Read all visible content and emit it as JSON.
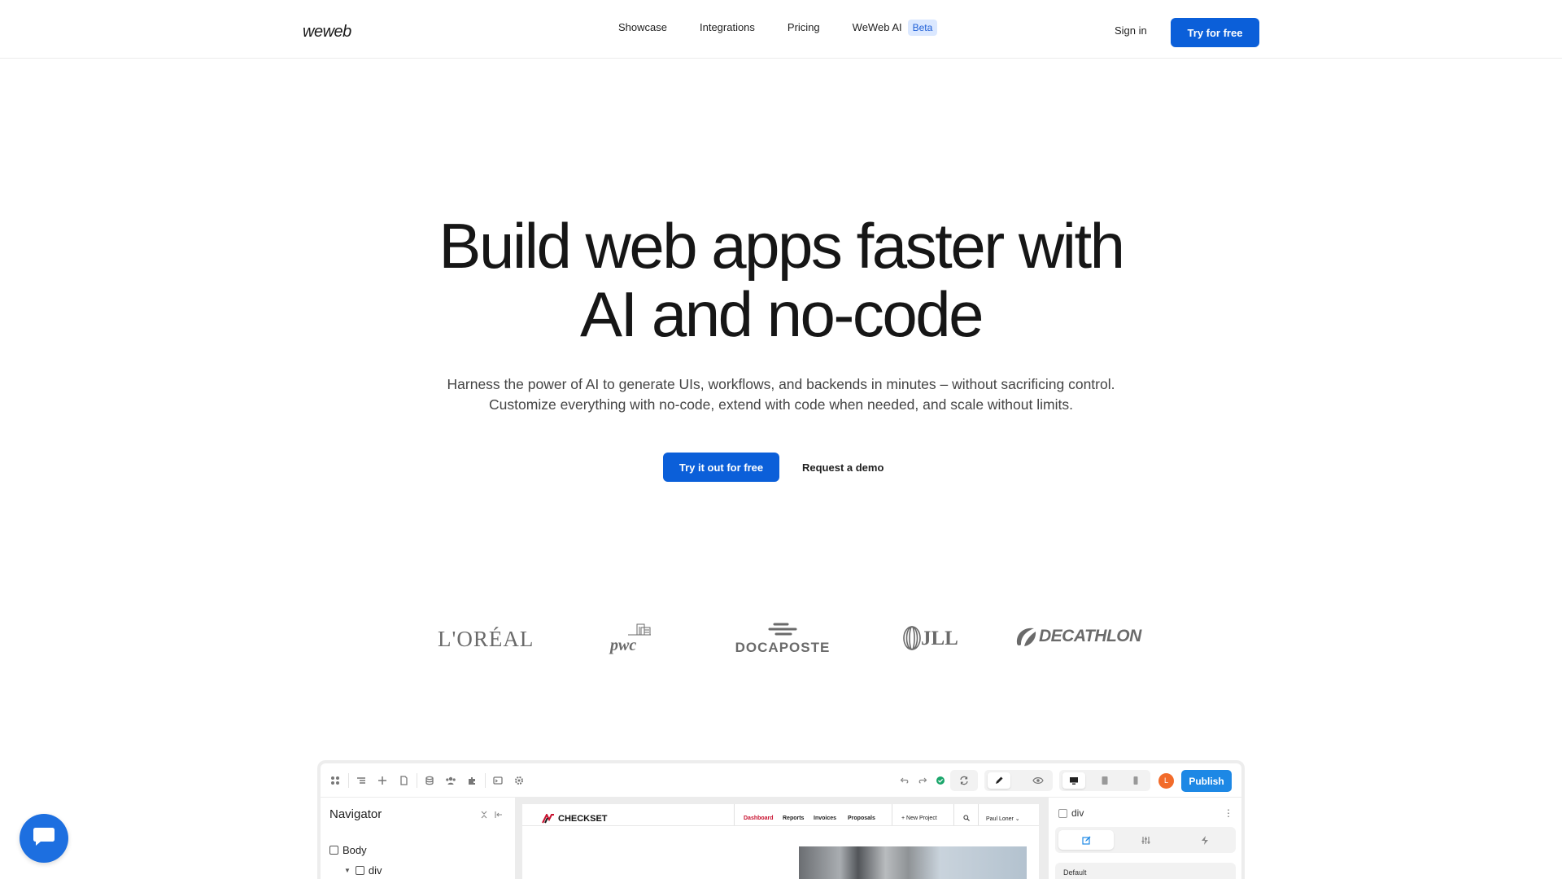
{
  "header": {
    "logo": "weweb",
    "nav": [
      "Showcase",
      "Integrations",
      "Pricing"
    ],
    "ai_link": "WeWeb AI",
    "ai_badge": "Beta",
    "signin": "Sign in",
    "cta": "Try for free"
  },
  "hero": {
    "title_line1": "Build web apps faster with",
    "title_line2": "AI and no-code",
    "subtitle_line1": "Harness the power of AI to generate UIs, workflows, and backends in minutes – without sacrificing control.",
    "subtitle_line2": "Customize everything with no-code, extend with code when needed, and scale without limits.",
    "primary_cta": "Try it out for free",
    "secondary_cta": "Request a demo"
  },
  "logos": {
    "loreal": "L'ORÉAL",
    "pwc": "pwc",
    "docaposte": "DOCAPOSTE",
    "jll": "JLL",
    "decathlon": "DECATHLON"
  },
  "editor": {
    "publish": "Publish",
    "avatar_initial": "L",
    "navigator": {
      "title": "Navigator",
      "tree": [
        "Body",
        "div"
      ]
    },
    "site": {
      "brand": "CHECKSET",
      "nav": [
        "Dashboard",
        "Reports",
        "Invoices",
        "Proposals"
      ],
      "new_project": "+ New Project",
      "user": "Paul Loner ⌄"
    },
    "props": {
      "element": "div",
      "state": "Default"
    }
  },
  "colors": {
    "primary": "#0b5fd9",
    "beta_bg": "#dbe8ff",
    "publish": "#1d88e5",
    "checkset_red": "#c8102e",
    "avatar": "#f26b2a",
    "chat": "#1d6fe0"
  },
  "icons": [
    "grid-icon",
    "layers-icon",
    "plus-icon",
    "page-icon",
    "database-icon",
    "users-icon",
    "plugin-icon",
    "terminal-icon",
    "gear-icon",
    "undo-icon",
    "redo-icon",
    "status-ok-icon",
    "sync-icon",
    "edit-mode-icon",
    "preview-icon",
    "desktop-icon",
    "tablet-icon",
    "mobile-icon",
    "chat-icon"
  ]
}
